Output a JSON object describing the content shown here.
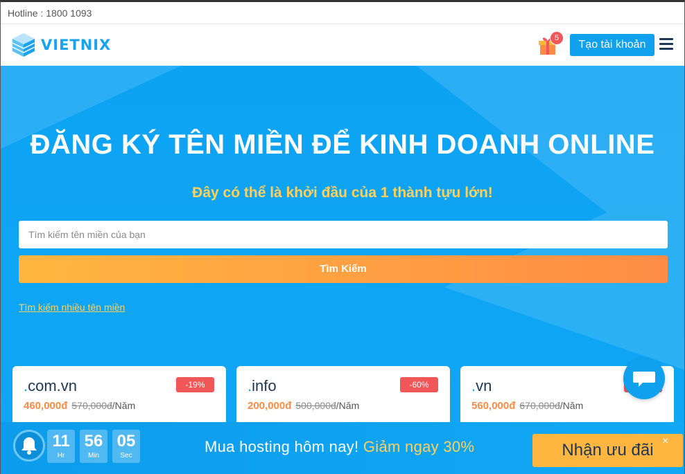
{
  "topbar": {
    "hotline": "Hotline : 1800 1093"
  },
  "header": {
    "logo_text": "VIETNIX",
    "gift_count": "5",
    "account_button": "Tạo tài khoản"
  },
  "hero": {
    "title": "ĐĂNG KÝ TÊN MIỀN ĐỂ KINH DOANH ONLINE",
    "subtitle": "Đây có thể là khởi đầu của 1 thành tựu lớn!",
    "search_placeholder": "Tìm kiếm tên miền của bạn",
    "search_button": "Tìm Kiếm",
    "multi_search_link": "Tìm kiếm nhiều tên miền"
  },
  "domains": [
    {
      "ext": "com.vn",
      "discount": "-19%",
      "price": "460,000đ",
      "old_price": "570,000đ",
      "unit": "/Năm"
    },
    {
      "ext": "info",
      "discount": "-60%",
      "price": "200,000đ",
      "old_price": "500,000đ",
      "unit": "/Năm"
    },
    {
      "ext": "vn",
      "discount": "",
      "price": "560,000đ",
      "old_price": "670,000đ",
      "unit": "/Năm"
    }
  ],
  "promo": {
    "countdown": [
      {
        "value": "11",
        "label": "Hr"
      },
      {
        "value": "56",
        "label": "Min"
      },
      {
        "value": "05",
        "label": "Sec"
      }
    ],
    "text_main": "Mua hosting hôm nay! ",
    "text_highlight": "Giảm ngay 30%",
    "button": "Nhận ưu đãi",
    "close_icon": "×"
  },
  "colors": {
    "brand_blue": "#0fa0ee",
    "accent_orange": "#ff8c45",
    "accent_yellow": "#ffd15c",
    "discount_red": "#f25757",
    "navy": "#1d3654"
  },
  "icons": [
    "logo-cube-icon",
    "gift-icon",
    "hamburger-menu-icon",
    "chat-icon",
    "bell-icon",
    "close-icon"
  ]
}
